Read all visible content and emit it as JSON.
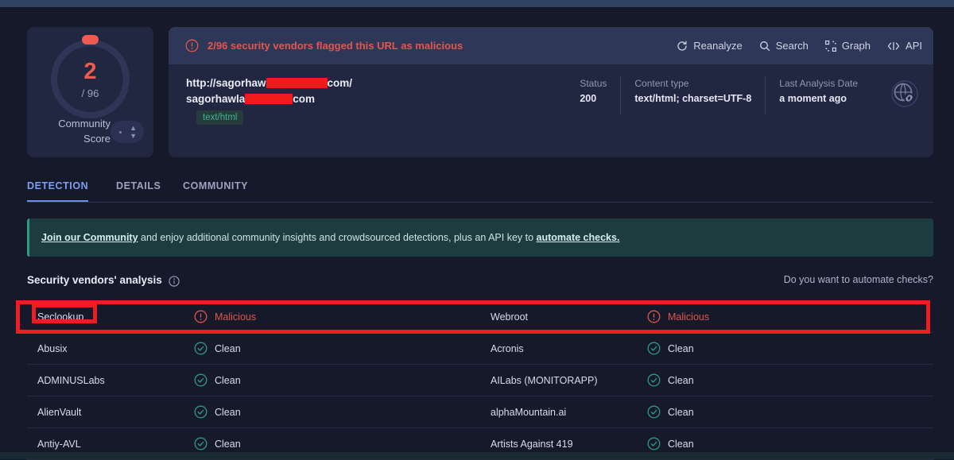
{
  "score_card": {
    "value": "2",
    "total": "/ 96",
    "label_line1": "Community",
    "label_line2": "Score",
    "vote_up_icon": "caret-up-icon",
    "vote_down_icon": "caret-down-icon"
  },
  "alert": {
    "icon": "exclamation-circle-icon",
    "text": "2/96 security vendors flagged this URL as malicious"
  },
  "toolbar": [
    {
      "label": "Reanalyze",
      "icon": "refresh-icon"
    },
    {
      "label": "Search",
      "icon": "search-icon"
    },
    {
      "label": "Graph",
      "icon": "graph-icon"
    },
    {
      "label": "API",
      "icon": "api-icon"
    }
  ],
  "url": {
    "line1_prefix": "http://sagorhaw",
    "line1_suffix": "com/",
    "line2_prefix": "sagorhawla",
    "line2_suffix": "com",
    "tag": "text/html"
  },
  "meta": [
    {
      "label": "Status",
      "value": "200"
    },
    {
      "label": "Content type",
      "value": "text/html; charset=UTF-8"
    },
    {
      "label": "Last Analysis Date",
      "value": "a moment ago"
    }
  ],
  "globe_icon": "globe-link-icon",
  "tabs": [
    {
      "label": "DETECTION",
      "active": true
    },
    {
      "label": "DETAILS",
      "active": false
    },
    {
      "label": "COMMUNITY",
      "active": false
    }
  ],
  "banner": {
    "link1": "Join our Community",
    "mid": " and enjoy additional community insights and crowdsourced detections, plus an API key to ",
    "link2": "automate checks."
  },
  "vendors_section": {
    "title": "Security vendors' analysis",
    "info_icon": "info-circle-icon",
    "automate_link": "Do you want to automate checks?"
  },
  "vendor_rows": [
    {
      "left": {
        "name": "Seclookup",
        "verdict": "Malicious",
        "status": "malicious",
        "icon": "exclamation-circle-icon"
      },
      "right": {
        "name": "Webroot",
        "verdict": "Malicious",
        "status": "malicious",
        "icon": "exclamation-circle-icon"
      }
    },
    {
      "left": {
        "name": "Abusix",
        "verdict": "Clean",
        "status": "clean",
        "icon": "check-circle-icon"
      },
      "right": {
        "name": "Acronis",
        "verdict": "Clean",
        "status": "clean",
        "icon": "check-circle-icon"
      }
    },
    {
      "left": {
        "name": "ADMINUSLabs",
        "verdict": "Clean",
        "status": "clean",
        "icon": "check-circle-icon"
      },
      "right": {
        "name": "AILabs (MONITORAPP)",
        "verdict": "Clean",
        "status": "clean",
        "icon": "check-circle-icon"
      }
    },
    {
      "left": {
        "name": "AlienVault",
        "verdict": "Clean",
        "status": "clean",
        "icon": "check-circle-icon"
      },
      "right": {
        "name": "alphaMountain.ai",
        "verdict": "Clean",
        "status": "clean",
        "icon": "check-circle-icon"
      }
    },
    {
      "left": {
        "name": "Antiy-AVL",
        "verdict": "Clean",
        "status": "clean",
        "icon": "check-circle-icon"
      },
      "right": {
        "name": "Artists Against 419",
        "verdict": "Clean",
        "status": "clean",
        "icon": "check-circle-icon"
      }
    }
  ],
  "colors": {
    "page_bg": "#16192a",
    "card_bg": "#222741",
    "alert_bg": "#2e3757",
    "malicious": "#e0564b",
    "clean": "#2e9b86",
    "accent_tab": "#7b9ff0",
    "banner_bg": "#1c3c40",
    "annotation": "#ee1d24",
    "redaction": "#f01b1b"
  }
}
